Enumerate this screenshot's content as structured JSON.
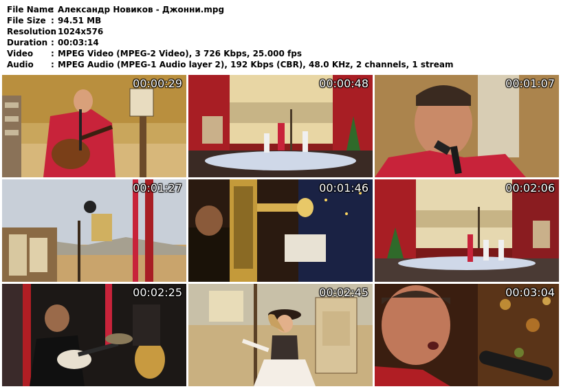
{
  "info": [
    {
      "key": "File Name",
      "value": "Александр Новиков - Джонни.mpg"
    },
    {
      "key": "File Size",
      "value": "94.51 MB"
    },
    {
      "key": "Resolution",
      "value": "1024x576"
    },
    {
      "key": "Duration",
      "value": "00:03:14"
    },
    {
      "key": "Video",
      "value": "MPEG Video (MPEG-2 Video), 3 726 Kbps, 25.000 fps"
    },
    {
      "key": "Audio",
      "value": "MPEG Audio (MPEG-1 Audio layer 2), 192 Kbps (CBR), 48.0 KHz, 2 channels, 1 stream"
    }
  ],
  "separator": ":",
  "thumbnails": [
    {
      "time": "00:00:29"
    },
    {
      "time": "00:00:48"
    },
    {
      "time": "00:01:07"
    },
    {
      "time": "00:01:27"
    },
    {
      "time": "00:01:46"
    },
    {
      "time": "00:02:06"
    },
    {
      "time": "00:02:25"
    },
    {
      "time": "00:02:45"
    },
    {
      "time": "00:03:04"
    }
  ]
}
